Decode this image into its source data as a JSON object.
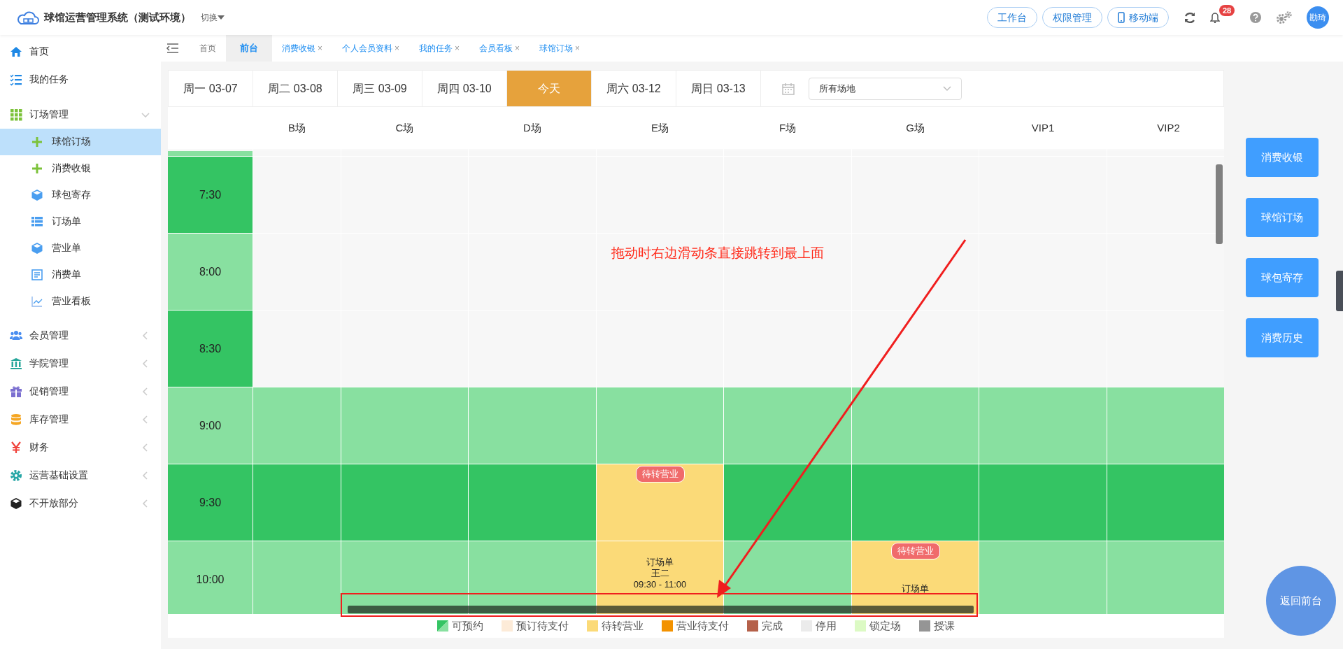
{
  "header": {
    "title": "球馆运营管理系统（测试环境）",
    "switch_label": "切换",
    "buttons": [
      {
        "label": "工作台",
        "kind": "plain"
      },
      {
        "label": "权限管理",
        "kind": "plain"
      },
      {
        "label": "移动端",
        "kind": "phone"
      }
    ],
    "notification_count": "28",
    "avatar": "勘琦"
  },
  "sidebar": {
    "items": [
      {
        "label": "首页",
        "selected": false
      },
      {
        "label": "我的任务",
        "selected": false
      },
      {
        "label": "订场管理",
        "selected": false,
        "expanded": true,
        "children": [
          {
            "label": "球馆订场",
            "selected": true
          },
          {
            "label": "消费收银",
            "selected": false
          },
          {
            "label": "球包寄存",
            "selected": false
          },
          {
            "label": "订场单",
            "selected": false
          },
          {
            "label": "营业单",
            "selected": false
          },
          {
            "label": "消费单",
            "selected": false
          },
          {
            "label": "营业看板",
            "selected": false
          }
        ]
      },
      {
        "label": "会员管理",
        "selected": false,
        "expanded": false
      },
      {
        "label": "学院管理",
        "selected": false,
        "expanded": false
      },
      {
        "label": "促销管理",
        "selected": false,
        "expanded": false
      },
      {
        "label": "库存管理",
        "selected": false,
        "expanded": false
      },
      {
        "label": "财务",
        "selected": false,
        "expanded": false
      },
      {
        "label": "运营基础设置",
        "selected": false,
        "expanded": false
      },
      {
        "label": "不开放部分",
        "selected": false,
        "expanded": false
      }
    ]
  },
  "page_tabs": [
    {
      "label": "首页",
      "selected": false,
      "closable": false
    },
    {
      "label": "前台",
      "selected": true,
      "closable": false
    },
    {
      "label": "消费收银",
      "selected": false,
      "closable": true
    },
    {
      "label": "个人会员资料",
      "selected": false,
      "closable": true
    },
    {
      "label": "我的任务",
      "selected": false,
      "closable": true
    },
    {
      "label": "会员看板",
      "selected": false,
      "closable": true
    },
    {
      "label": "球馆订场",
      "selected": false,
      "closable": true
    }
  ],
  "close_glyph": "×",
  "date_tabs": [
    {
      "label": "周一 03-07",
      "selected": false
    },
    {
      "label": "周二 03-08",
      "selected": false
    },
    {
      "label": "周三 03-09",
      "selected": false
    },
    {
      "label": "周四 03-10",
      "selected": false
    },
    {
      "label": "今天",
      "selected": true
    },
    {
      "label": "周六 03-12",
      "selected": false
    },
    {
      "label": "周日 03-13",
      "selected": false
    }
  ],
  "venue_select": {
    "value": "所有场地"
  },
  "columns": [
    "B场",
    "C场",
    "D场",
    "E场",
    "F场",
    "G场",
    "VIP1",
    "VIP2"
  ],
  "rows": [
    {
      "time": "7:30",
      "dark": true,
      "cells": [
        {
          "kind": "closed"
        },
        {
          "kind": "closed"
        },
        {
          "kind": "closed"
        },
        {
          "kind": "closed"
        },
        {
          "kind": "closed"
        },
        {
          "kind": "closed"
        },
        {
          "kind": "closed"
        },
        {
          "kind": "closed"
        }
      ]
    },
    {
      "time": "8:00",
      "dark": false,
      "cells": [
        {
          "kind": "closed"
        },
        {
          "kind": "closed"
        },
        {
          "kind": "closed"
        },
        {
          "kind": "closed"
        },
        {
          "kind": "closed"
        },
        {
          "kind": "closed"
        },
        {
          "kind": "closed"
        },
        {
          "kind": "closed"
        }
      ]
    },
    {
      "time": "8:30",
      "dark": true,
      "cells": [
        {
          "kind": "closed"
        },
        {
          "kind": "closed"
        },
        {
          "kind": "closed"
        },
        {
          "kind": "closed"
        },
        {
          "kind": "closed"
        },
        {
          "kind": "closed"
        },
        {
          "kind": "closed"
        },
        {
          "kind": "closed"
        }
      ]
    },
    {
      "time": "9:00",
      "dark": false,
      "cells": [
        {
          "kind": "free"
        },
        {
          "kind": "free"
        },
        {
          "kind": "free"
        },
        {
          "kind": "free"
        },
        {
          "kind": "free"
        },
        {
          "kind": "free"
        },
        {
          "kind": "free"
        },
        {
          "kind": "free"
        }
      ]
    },
    {
      "time": "9:30",
      "dark": true,
      "cells": [
        {
          "kind": "free"
        },
        {
          "kind": "free"
        },
        {
          "kind": "free"
        },
        {
          "kind": "booking",
          "badge": "待转营业"
        },
        {
          "kind": "free"
        },
        {
          "kind": "free"
        },
        {
          "kind": "free"
        },
        {
          "kind": "free"
        }
      ]
    },
    {
      "time": "10:00",
      "dark": false,
      "cells": [
        {
          "kind": "free"
        },
        {
          "kind": "free"
        },
        {
          "kind": "free"
        },
        {
          "kind": "booking",
          "lines": [
            "订场单",
            "王二",
            "09:30 - 11:00"
          ]
        },
        {
          "kind": "free"
        },
        {
          "kind": "booking",
          "badge": "待转营业",
          "lines": [
            "订场单"
          ]
        },
        {
          "kind": "free"
        },
        {
          "kind": "free"
        }
      ]
    }
  ],
  "legend": [
    {
      "label": "可预约",
      "color": "#34c463",
      "kind": "split"
    },
    {
      "label": "预订待支付",
      "color": "#fdebd8",
      "kind": "solid"
    },
    {
      "label": "待转营业",
      "color": "#fbda78",
      "kind": "solid"
    },
    {
      "label": "营业待支付",
      "color": "#f39200",
      "kind": "solid"
    },
    {
      "label": "完成",
      "color": "#b5614a",
      "kind": "solid"
    },
    {
      "label": "停用",
      "color": "#ebebeb",
      "kind": "solid"
    },
    {
      "label": "锁定场",
      "color": "#dcfac4",
      "kind": "solid"
    },
    {
      "label": "授课",
      "color": "#959595",
      "kind": "solid"
    }
  ],
  "side_buttons": [
    "消费收银",
    "球馆订场",
    "球包寄存",
    "消费历史"
  ],
  "back_button": "返回前台",
  "annotation": {
    "text": "拖动时右边滑动条直接跳转到最上面"
  }
}
